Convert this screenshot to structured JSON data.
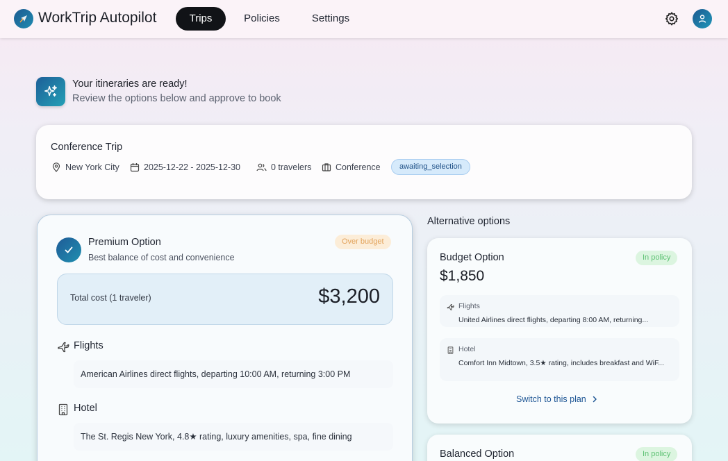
{
  "app": {
    "title": "WorkTrip Autopilot"
  },
  "nav": {
    "tabs": [
      {
        "label": "Trips",
        "active": true
      },
      {
        "label": "Policies",
        "active": false
      },
      {
        "label": "Settings",
        "active": false
      }
    ]
  },
  "header_icons": {
    "settings": "gear-icon",
    "account": "user-icon"
  },
  "banner": {
    "title": "Your itineraries are ready!",
    "subtitle": "Review the options below and approve to book",
    "icon": "sparkles-icon"
  },
  "trip": {
    "name": "Conference Trip",
    "location": "New York City",
    "dates": "2025-12-22 - 2025-12-30",
    "travelers": "0 travelers",
    "type": "Conference",
    "status": "awaiting_selection"
  },
  "selected_option": {
    "title": "Premium Option",
    "subtitle": "Best balance of cost and convenience",
    "badge": "Over budget",
    "total_label": "Total cost (1 traveler)",
    "total_value": "$3,200",
    "flights_title": "Flights",
    "flights_text": "American Airlines direct flights, departing 10:00 AM, returning 3:00 PM",
    "hotel_title": "Hotel",
    "hotel_text": "The St. Regis New York, 4.8★ rating, luxury amenities, spa, fine dining"
  },
  "alternatives": {
    "heading": "Alternative options",
    "options": [
      {
        "title": "Budget Option",
        "badge": "In policy",
        "price": "$1,850",
        "flights_label": "Flights",
        "flights_text": "United Airlines direct flights, departing 8:00 AM, returning...",
        "hotel_label": "Hotel",
        "hotel_text": "Comfort Inn Midtown, 3.5★ rating, includes breakfast and WiF...",
        "switch_label": "Switch to this plan"
      },
      {
        "title": "Balanced Option",
        "badge": "In policy"
      }
    ]
  },
  "colors": {
    "accent": "#1d5f98",
    "status_pill_bg": "#d6eafb",
    "over_budget": "#e2a25a",
    "in_policy": "#5cc172"
  }
}
